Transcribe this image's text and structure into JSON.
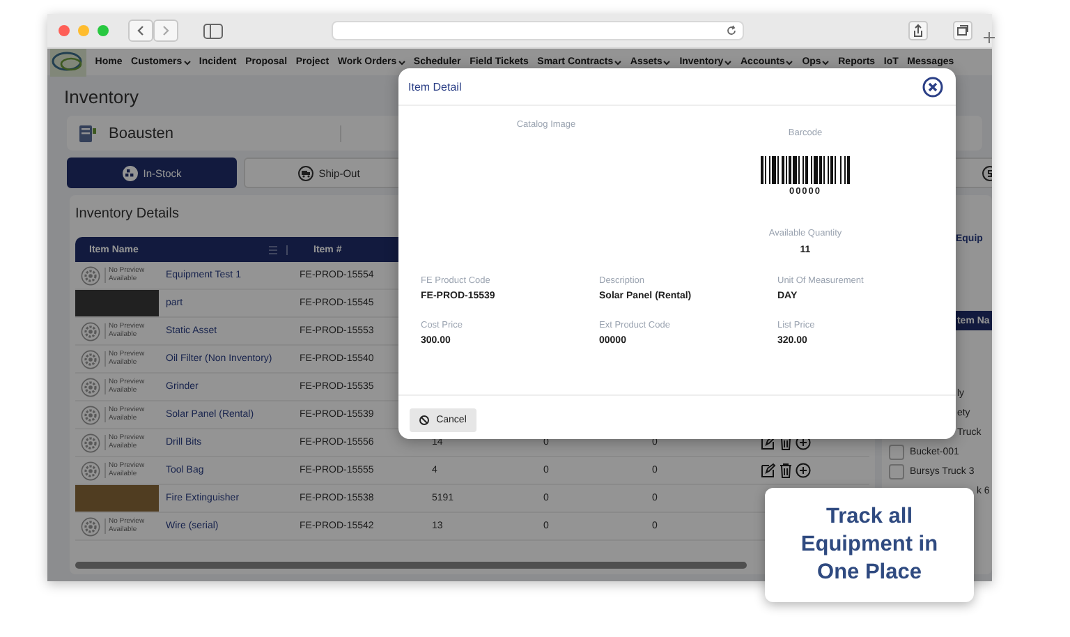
{
  "nav": [
    {
      "label": "Home",
      "dropdown": false
    },
    {
      "label": "Customers",
      "dropdown": true
    },
    {
      "label": "Incident",
      "dropdown": false
    },
    {
      "label": "Proposal",
      "dropdown": false
    },
    {
      "label": "Project",
      "dropdown": false
    },
    {
      "label": "Work Orders",
      "dropdown": true
    },
    {
      "label": "Scheduler",
      "dropdown": false
    },
    {
      "label": "Field Tickets",
      "dropdown": false
    },
    {
      "label": "Smart Contracts",
      "dropdown": true
    },
    {
      "label": "Assets",
      "dropdown": true
    },
    {
      "label": "Inventory",
      "dropdown": true
    },
    {
      "label": "Accounts",
      "dropdown": true
    },
    {
      "label": "Ops",
      "dropdown": true
    },
    {
      "label": "Reports",
      "dropdown": false
    },
    {
      "label": "IoT",
      "dropdown": false
    },
    {
      "label": "Messages",
      "dropdown": false
    }
  ],
  "page_title": "Inventory",
  "location": {
    "name": "Boausten"
  },
  "tabs": [
    {
      "label": "In-Stock",
      "selected": true
    },
    {
      "label": "Ship-Out",
      "selected": false
    }
  ],
  "details": {
    "title": "Inventory Details",
    "columns": [
      "Item Name",
      "Item #"
    ],
    "rows": [
      {
        "photo": false,
        "preview": "No Preview Available",
        "name": "Equipment Test 1",
        "item_no": "FE-PROD-15554"
      },
      {
        "photo": true,
        "name": "part",
        "item_no": "FE-PROD-15545"
      },
      {
        "photo": false,
        "preview": "No Preview Available",
        "name": "Static Asset",
        "item_no": "FE-PROD-15553"
      },
      {
        "photo": false,
        "preview": "No Preview Available",
        "name": "Oil Filter (Non Inventory)",
        "item_no": "FE-PROD-15540"
      },
      {
        "photo": false,
        "preview": "No Preview Available",
        "name": "Grinder",
        "item_no": "FE-PROD-15535"
      },
      {
        "photo": false,
        "preview": "No Preview Available",
        "name": "Solar Panel (Rental)",
        "item_no": "FE-PROD-15539"
      },
      {
        "photo": false,
        "preview": "No Preview Available",
        "name": "Drill Bits",
        "item_no": "FE-PROD-15556",
        "column_3": "14",
        "column_4": "0",
        "column_5": "0",
        "actions": true
      },
      {
        "photo": false,
        "preview": "No Preview Available",
        "name": "Tool Bag",
        "item_no": "FE-PROD-15555",
        "column_3": "4",
        "column_4": "0",
        "column_5": "0",
        "actions": true
      },
      {
        "photo": true,
        "name": "Fire Extinguisher",
        "item_no": "FE-PROD-15538",
        "column_3": "5191",
        "column_4": "0",
        "column_5": "0",
        "actions": false
      },
      {
        "photo": false,
        "preview": "No Preview Available",
        "name": "Wire (serial)",
        "item_no": "FE-PROD-15542",
        "column_3": "13",
        "column_4": "0",
        "column_5": "0",
        "actions": false
      }
    ]
  },
  "side_panel": {
    "title": "Equip",
    "header": "tem Na",
    "items": [
      {
        "kind": "cut",
        "label": "ly"
      },
      {
        "kind": "cut",
        "label": "ety"
      },
      {
        "kind": "cut",
        "label": "Truck"
      },
      {
        "kind": "checkbox",
        "label": "Bucket-001",
        "checked": false
      },
      {
        "kind": "checkbox",
        "label": "Bursys Truck 3",
        "checked": false
      },
      {
        "kind": "far",
        "label": "k 6"
      }
    ]
  },
  "modal": {
    "title": "Item Detail",
    "catalog_label": "Catalog Image",
    "barcode_label": "Barcode",
    "barcode_value": "00000",
    "quantity_label": "Available Quantity",
    "quantity": "11",
    "fields": [
      {
        "label": "FE Product Code",
        "value": "FE-PROD-15539"
      },
      {
        "label": "Description",
        "value": "Solar Panel (Rental)"
      },
      {
        "label": "Unit Of Measurement",
        "value": "DAY"
      },
      {
        "label": "Cost Price",
        "value": "300.00"
      },
      {
        "label": "Ext Product Code",
        "value": "00000"
      },
      {
        "label": "List Price",
        "value": "320.00"
      }
    ],
    "cancel": "Cancel"
  },
  "callout": "Track all Equipment in One Place"
}
